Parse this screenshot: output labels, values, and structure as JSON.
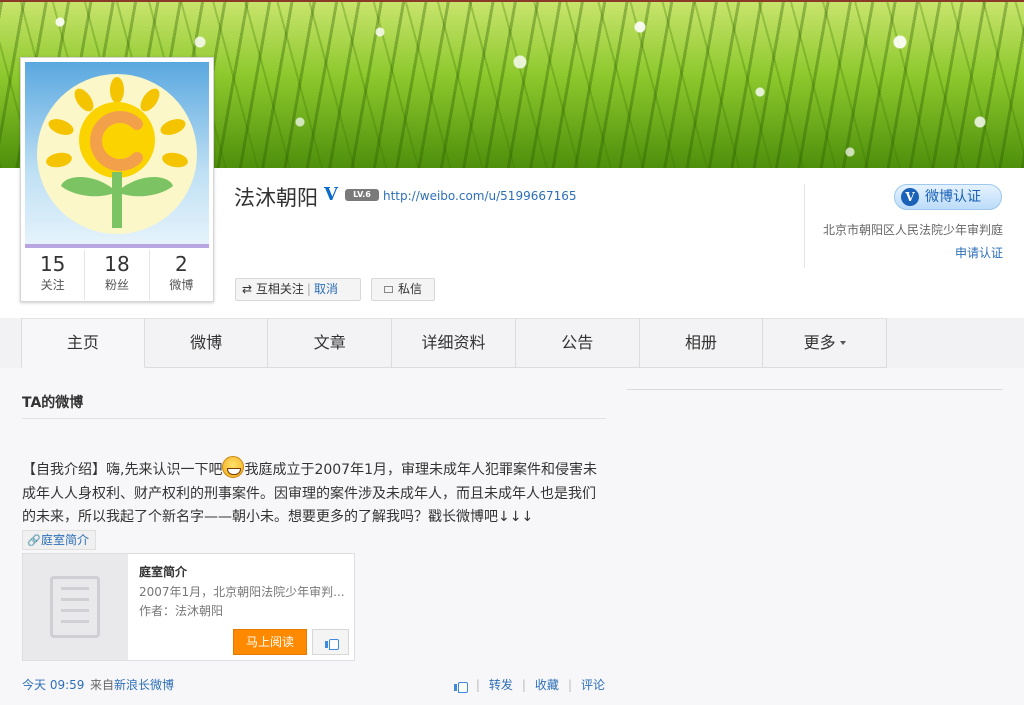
{
  "profile": {
    "name": "法沐朝阳",
    "level": "LV.6",
    "url": "http://weibo.com/u/5199667165",
    "stats": [
      {
        "num": "15",
        "label": "关注"
      },
      {
        "num": "18",
        "label": "粉丝"
      },
      {
        "num": "2",
        "label": "微博"
      }
    ],
    "follow_label": "互相关注",
    "cancel_label": "取消",
    "message_label": "私信"
  },
  "verify": {
    "badge_label": "微博认证",
    "description": "北京市朝阳区人民法院少年审判庭",
    "apply_label": "申请认证"
  },
  "tabs": [
    "主页",
    "微博",
    "文章",
    "详细资料",
    "公告",
    "相册",
    "更多"
  ],
  "feed": {
    "section_title": "TA的微博",
    "post": {
      "text_part1": "【自我介绍】嗨,先来认识一下吧",
      "text_part2": "我庭成立于2007年1月，审理未成年人犯罪案件和侵害未成年人人身权利、财产权利的刑事案件。因审理的案件涉及未成年人，而且未成年人也是我们的未来，所以我起了个新名字——朝小未。想要更多的了解我吗？戳长微博吧↓↓↓",
      "link_label": "庭室简介",
      "card": {
        "title": "庭室简介",
        "desc": "2007年1月，北京朝阳法院少年审判...",
        "author": "作者：法沐朝阳",
        "read_label": "马上阅读"
      },
      "time": "今天 09:59",
      "source_prefix": "来自",
      "source": "新浪长微博",
      "actions": {
        "repost": "转发",
        "favorite": "收藏",
        "comment": "评论"
      }
    }
  },
  "colors": {
    "link": "#2d6fb8",
    "accent": "#ff8a00",
    "verify": "#1a62b8"
  }
}
